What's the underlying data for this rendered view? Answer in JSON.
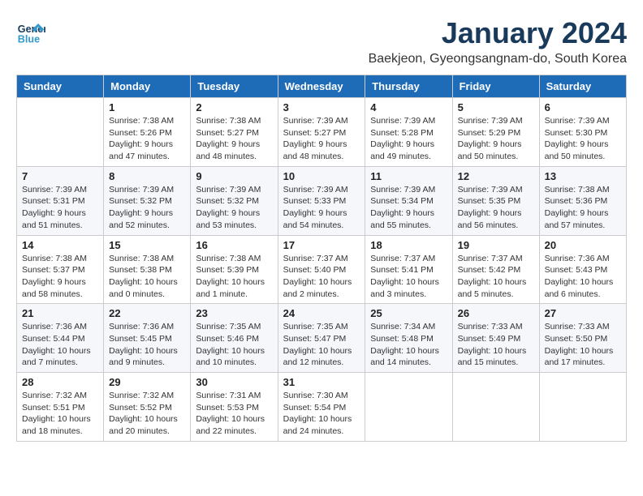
{
  "logo": {
    "line1": "General",
    "line2": "Blue"
  },
  "title": "January 2024",
  "subtitle": "Baekjeon, Gyeongsangnam-do, South Korea",
  "weekdays": [
    "Sunday",
    "Monday",
    "Tuesday",
    "Wednesday",
    "Thursday",
    "Friday",
    "Saturday"
  ],
  "weeks": [
    [
      {
        "day": "",
        "sunrise": "",
        "sunset": "",
        "daylight": ""
      },
      {
        "day": "1",
        "sunrise": "Sunrise: 7:38 AM",
        "sunset": "Sunset: 5:26 PM",
        "daylight": "Daylight: 9 hours and 47 minutes."
      },
      {
        "day": "2",
        "sunrise": "Sunrise: 7:38 AM",
        "sunset": "Sunset: 5:27 PM",
        "daylight": "Daylight: 9 hours and 48 minutes."
      },
      {
        "day": "3",
        "sunrise": "Sunrise: 7:39 AM",
        "sunset": "Sunset: 5:27 PM",
        "daylight": "Daylight: 9 hours and 48 minutes."
      },
      {
        "day": "4",
        "sunrise": "Sunrise: 7:39 AM",
        "sunset": "Sunset: 5:28 PM",
        "daylight": "Daylight: 9 hours and 49 minutes."
      },
      {
        "day": "5",
        "sunrise": "Sunrise: 7:39 AM",
        "sunset": "Sunset: 5:29 PM",
        "daylight": "Daylight: 9 hours and 50 minutes."
      },
      {
        "day": "6",
        "sunrise": "Sunrise: 7:39 AM",
        "sunset": "Sunset: 5:30 PM",
        "daylight": "Daylight: 9 hours and 50 minutes."
      }
    ],
    [
      {
        "day": "7",
        "sunrise": "Sunrise: 7:39 AM",
        "sunset": "Sunset: 5:31 PM",
        "daylight": "Daylight: 9 hours and 51 minutes."
      },
      {
        "day": "8",
        "sunrise": "Sunrise: 7:39 AM",
        "sunset": "Sunset: 5:32 PM",
        "daylight": "Daylight: 9 hours and 52 minutes."
      },
      {
        "day": "9",
        "sunrise": "Sunrise: 7:39 AM",
        "sunset": "Sunset: 5:32 PM",
        "daylight": "Daylight: 9 hours and 53 minutes."
      },
      {
        "day": "10",
        "sunrise": "Sunrise: 7:39 AM",
        "sunset": "Sunset: 5:33 PM",
        "daylight": "Daylight: 9 hours and 54 minutes."
      },
      {
        "day": "11",
        "sunrise": "Sunrise: 7:39 AM",
        "sunset": "Sunset: 5:34 PM",
        "daylight": "Daylight: 9 hours and 55 minutes."
      },
      {
        "day": "12",
        "sunrise": "Sunrise: 7:39 AM",
        "sunset": "Sunset: 5:35 PM",
        "daylight": "Daylight: 9 hours and 56 minutes."
      },
      {
        "day": "13",
        "sunrise": "Sunrise: 7:38 AM",
        "sunset": "Sunset: 5:36 PM",
        "daylight": "Daylight: 9 hours and 57 minutes."
      }
    ],
    [
      {
        "day": "14",
        "sunrise": "Sunrise: 7:38 AM",
        "sunset": "Sunset: 5:37 PM",
        "daylight": "Daylight: 9 hours and 58 minutes."
      },
      {
        "day": "15",
        "sunrise": "Sunrise: 7:38 AM",
        "sunset": "Sunset: 5:38 PM",
        "daylight": "Daylight: 10 hours and 0 minutes."
      },
      {
        "day": "16",
        "sunrise": "Sunrise: 7:38 AM",
        "sunset": "Sunset: 5:39 PM",
        "daylight": "Daylight: 10 hours and 1 minute."
      },
      {
        "day": "17",
        "sunrise": "Sunrise: 7:37 AM",
        "sunset": "Sunset: 5:40 PM",
        "daylight": "Daylight: 10 hours and 2 minutes."
      },
      {
        "day": "18",
        "sunrise": "Sunrise: 7:37 AM",
        "sunset": "Sunset: 5:41 PM",
        "daylight": "Daylight: 10 hours and 3 minutes."
      },
      {
        "day": "19",
        "sunrise": "Sunrise: 7:37 AM",
        "sunset": "Sunset: 5:42 PM",
        "daylight": "Daylight: 10 hours and 5 minutes."
      },
      {
        "day": "20",
        "sunrise": "Sunrise: 7:36 AM",
        "sunset": "Sunset: 5:43 PM",
        "daylight": "Daylight: 10 hours and 6 minutes."
      }
    ],
    [
      {
        "day": "21",
        "sunrise": "Sunrise: 7:36 AM",
        "sunset": "Sunset: 5:44 PM",
        "daylight": "Daylight: 10 hours and 7 minutes."
      },
      {
        "day": "22",
        "sunrise": "Sunrise: 7:36 AM",
        "sunset": "Sunset: 5:45 PM",
        "daylight": "Daylight: 10 hours and 9 minutes."
      },
      {
        "day": "23",
        "sunrise": "Sunrise: 7:35 AM",
        "sunset": "Sunset: 5:46 PM",
        "daylight": "Daylight: 10 hours and 10 minutes."
      },
      {
        "day": "24",
        "sunrise": "Sunrise: 7:35 AM",
        "sunset": "Sunset: 5:47 PM",
        "daylight": "Daylight: 10 hours and 12 minutes."
      },
      {
        "day": "25",
        "sunrise": "Sunrise: 7:34 AM",
        "sunset": "Sunset: 5:48 PM",
        "daylight": "Daylight: 10 hours and 14 minutes."
      },
      {
        "day": "26",
        "sunrise": "Sunrise: 7:33 AM",
        "sunset": "Sunset: 5:49 PM",
        "daylight": "Daylight: 10 hours and 15 minutes."
      },
      {
        "day": "27",
        "sunrise": "Sunrise: 7:33 AM",
        "sunset": "Sunset: 5:50 PM",
        "daylight": "Daylight: 10 hours and 17 minutes."
      }
    ],
    [
      {
        "day": "28",
        "sunrise": "Sunrise: 7:32 AM",
        "sunset": "Sunset: 5:51 PM",
        "daylight": "Daylight: 10 hours and 18 minutes."
      },
      {
        "day": "29",
        "sunrise": "Sunrise: 7:32 AM",
        "sunset": "Sunset: 5:52 PM",
        "daylight": "Daylight: 10 hours and 20 minutes."
      },
      {
        "day": "30",
        "sunrise": "Sunrise: 7:31 AM",
        "sunset": "Sunset: 5:53 PM",
        "daylight": "Daylight: 10 hours and 22 minutes."
      },
      {
        "day": "31",
        "sunrise": "Sunrise: 7:30 AM",
        "sunset": "Sunset: 5:54 PM",
        "daylight": "Daylight: 10 hours and 24 minutes."
      },
      {
        "day": "",
        "sunrise": "",
        "sunset": "",
        "daylight": ""
      },
      {
        "day": "",
        "sunrise": "",
        "sunset": "",
        "daylight": ""
      },
      {
        "day": "",
        "sunrise": "",
        "sunset": "",
        "daylight": ""
      }
    ]
  ]
}
